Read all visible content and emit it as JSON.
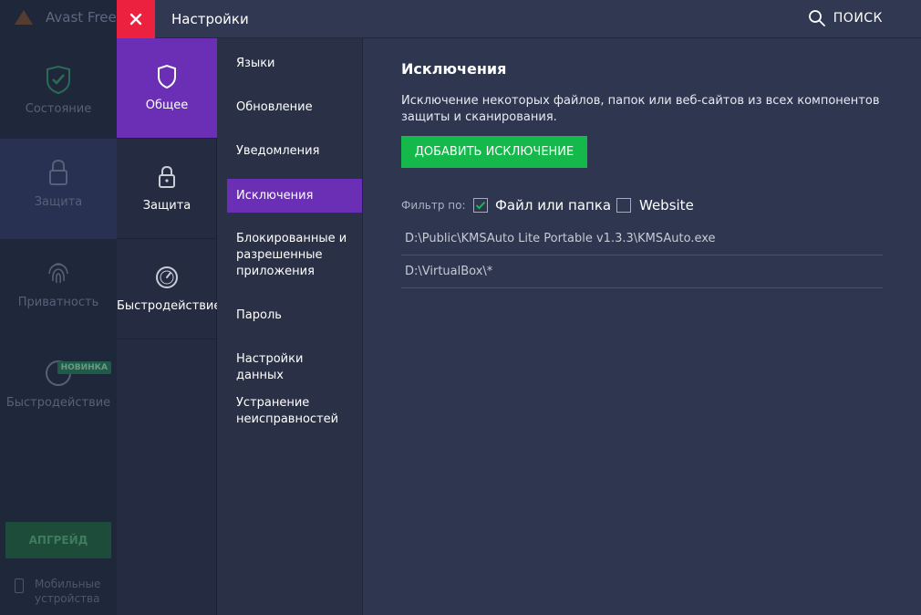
{
  "background_app": {
    "title": "Avast Free A",
    "items": [
      {
        "label": "Состояние",
        "icon": "shield-check-icon"
      },
      {
        "label": "Защита",
        "icon": "lock-icon"
      },
      {
        "label": "Приватность",
        "icon": "fingerprint-icon"
      },
      {
        "label": "Быстродействие",
        "icon": "speedometer-icon",
        "badge": "НОВИНКА"
      }
    ],
    "upgrade_label": "АПГРЕЙД",
    "mobile_line1": "Мобильные",
    "mobile_line2": "устройства"
  },
  "settings": {
    "title": "Настройки",
    "search_label": "ПОИСК",
    "categories": [
      {
        "label": "Общее",
        "icon": "shield-icon",
        "active": true
      },
      {
        "label": "Защита",
        "icon": "lock-icon"
      },
      {
        "label": "Быстродействие",
        "icon": "speedometer-icon"
      }
    ],
    "subsections": [
      {
        "label": "Языки"
      },
      {
        "label": "Обновление"
      },
      {
        "label": "Уведомления"
      },
      {
        "label": "Исключения",
        "active": true
      },
      {
        "label": "Блокированные и разрешенные приложения"
      },
      {
        "label": "Пароль"
      },
      {
        "label": "Настройки данных"
      },
      {
        "label": "Устранение неисправностей"
      }
    ]
  },
  "content": {
    "title": "Исключения",
    "description": "Исключение некоторых файлов, папок или веб-сайтов из всех компонентов защиты и сканирования.",
    "add_button": "ДОБАВИТЬ ИСКЛЮЧЕНИЕ",
    "filter_label": "Фильтр по:",
    "filters": [
      {
        "label": "Файл или папка",
        "checked": true
      },
      {
        "label": "Website",
        "checked": false
      }
    ],
    "exclusions": [
      "D:\\Public\\KMSAuto Lite Portable v1.3.3\\KMSAuto.exe",
      "D:\\VirtualBox\\*"
    ]
  },
  "colors": {
    "accent": "#6a2fb5",
    "close": "#ec2140",
    "primary_button": "#15b84a"
  }
}
